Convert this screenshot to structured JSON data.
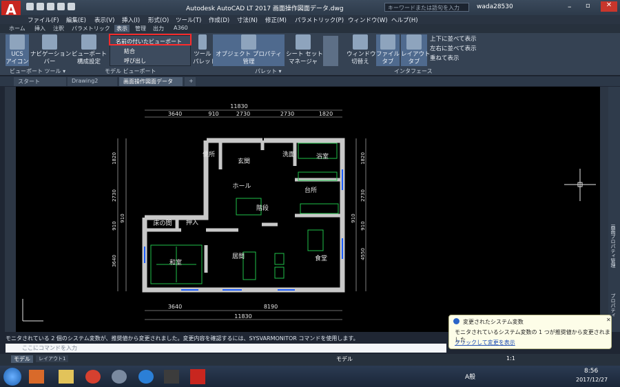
{
  "window": {
    "title": "Autodesk AutoCAD LT 2017    画面操作図面データ.dwg",
    "search_placeholder": "キーワードまたは語句を入力",
    "user": "wada28530"
  },
  "menu": [
    "ファイル(F)",
    "編集(E)",
    "表示(V)",
    "挿入(I)",
    "形式(O)",
    "ツール(T)",
    "作成(D)",
    "寸法(N)",
    "修正(M)",
    "パラメトリック(P)",
    "ウィンドウ(W)",
    "ヘルプ(H)"
  ],
  "ribbon_tabs": [
    "ホーム",
    "挿入",
    "注釈",
    "パラメトリック",
    "表示",
    "管理",
    "出力",
    "A360"
  ],
  "ribbon": {
    "ucs": "UCS\nアイコン",
    "nav": "ナビゲーション\nバー",
    "vp_config": "ビューポート\n構成設定",
    "named_vp": "名前の付いたビューポート",
    "join": "結合",
    "restore": "呼び出し",
    "tool_palette": "ツール\nパレット",
    "obj_props": "オブジェクト プロパティ管理",
    "sheetset": "シート セット\nマネージャ",
    "switch_win": "ウィンドウ\n切替え",
    "file_tab": "ファイル\nタブ",
    "layout_tab": "レイアウト\nタブ",
    "tile_h": "上下に並べて表示",
    "tile_v": "左右に並べて表示",
    "cascade": "重ねて表示",
    "panel_vp_tools": "ビューポート ツール ▾",
    "panel_model_vp": "モデル ビューポート",
    "panel_palette": "パレット ▾",
    "panel_interface": "インタフェース"
  },
  "doc_tabs": [
    "スタート",
    "Drawing2",
    "画面操作図面データ"
  ],
  "drawing": {
    "dims_top_total": "11830",
    "dims_top": [
      "3640",
      "910",
      "2730",
      "2730",
      "1820"
    ],
    "dims_bottom": [
      "3640",
      "8190"
    ],
    "dims_bottom_total": "11830",
    "dims_left": [
      "1820",
      "2730",
      "910",
      "3640"
    ],
    "dims_left_total": "910",
    "dims_right": [
      "1820",
      "2730",
      "910",
      "4550"
    ],
    "dims_right_total": "910",
    "rooms": {
      "toilet": "便所",
      "entrance": "玄関",
      "washroom": "洗面",
      "bath": "浴室",
      "hall": "ホール",
      "kitchen": "台所",
      "stairs": "階段",
      "tokonoma": "床の間",
      "oshiire": "押入",
      "washitsu": "和室",
      "living": "居間",
      "dining": "食堂"
    }
  },
  "right_palette_label": "画面プロパティ管理",
  "right_palette_label2": "プロパティ",
  "command": {
    "message": "モニタされている 2 個のシステム変数が、推奨値から変更されました。変更内容を確認するには、SYSVARMONITOR コマンドを使用します。",
    "placeholder": "ここにコマンドを入力"
  },
  "layout_tabs": [
    "モデル",
    "レイアウト1"
  ],
  "status": {
    "model": "モデル",
    "scale": "1:1"
  },
  "popup": {
    "title": "変更されたシステム変数",
    "body": "モニタされているシステム変数の 1 つが推奨値から変更されました",
    "link": "クリックして変更を表示"
  },
  "taskbar": {
    "time": "8:56",
    "date": "2017/12/27",
    "ime": "A般"
  }
}
